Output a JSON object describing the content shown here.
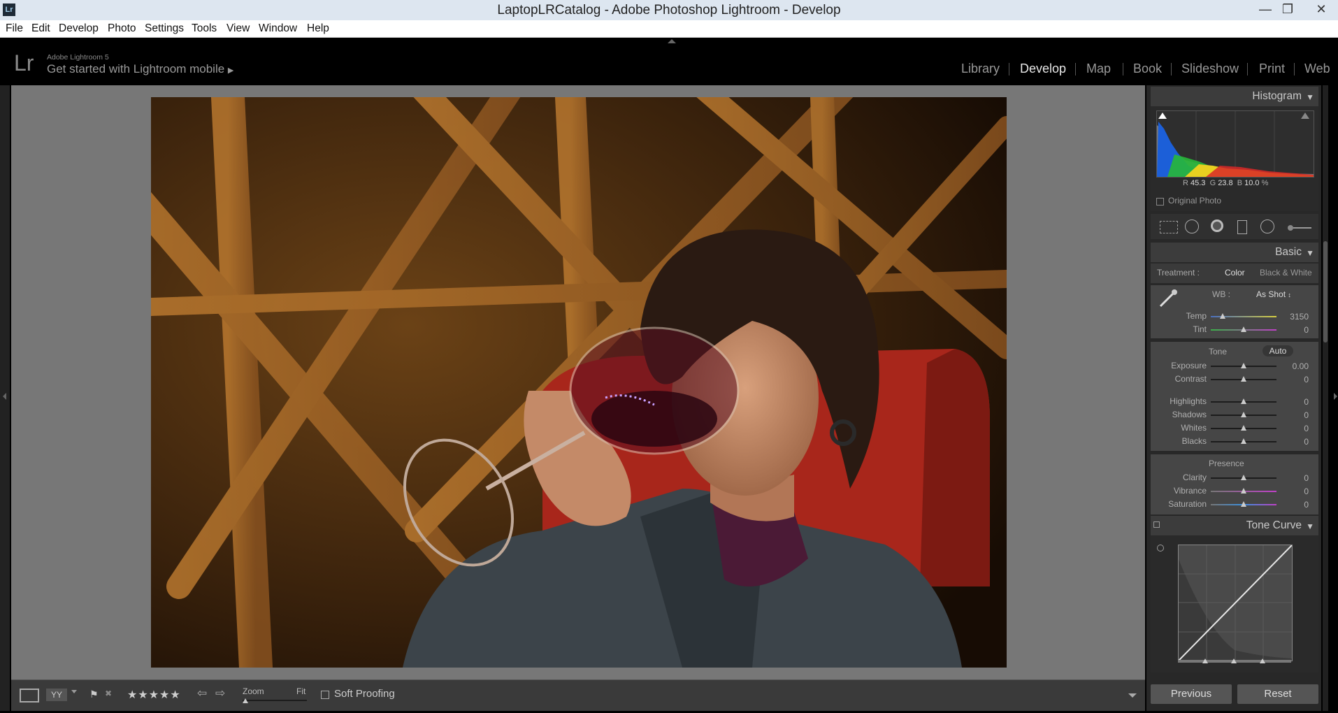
{
  "window": {
    "title": "LaptopLRCatalog - Adobe Photoshop Lightroom - Develop",
    "app_icon": "Lr",
    "controls": [
      "minimize-icon",
      "restore-icon",
      "close-icon"
    ]
  },
  "menu": [
    "File",
    "Edit",
    "Develop",
    "Photo",
    "Settings",
    "Tools",
    "View",
    "Window",
    "Help"
  ],
  "identity": {
    "logo": "Lr",
    "brand": "Adobe Lightroom 5",
    "mobile_text": "Get started with Lightroom mobile",
    "modules": [
      "Library",
      "Develop",
      "Map",
      "Book",
      "Slideshow",
      "Print",
      "Web"
    ],
    "active_module": "Develop"
  },
  "histogram": {
    "title": "Histogram",
    "r_label": "R",
    "r_value": "45.3",
    "g_label": "G",
    "g_value": "23.8",
    "b_label": "B",
    "b_value": "10.0",
    "unit": "%",
    "original_photo": "Original Photo"
  },
  "basic": {
    "title": "Basic",
    "treatment_label": "Treatment :",
    "color": "Color",
    "bw": "Black & White",
    "wb_label": "WB :",
    "wb_value": "As Shot",
    "temp_label": "Temp",
    "temp_value": "3150",
    "temp_pos": 0.18,
    "tint_label": "Tint",
    "tint_value": "0",
    "tint_pos": 0.5,
    "tone_label": "Tone",
    "auto": "Auto",
    "exposure_label": "Exposure",
    "exposure_value": "0.00",
    "contrast_label": "Contrast",
    "contrast_value": "0",
    "highlights_label": "Highlights",
    "highlights_value": "0",
    "shadows_label": "Shadows",
    "shadows_value": "0",
    "whites_label": "Whites",
    "whites_value": "0",
    "blacks_label": "Blacks",
    "blacks_value": "0",
    "presence_label": "Presence",
    "clarity_label": "Clarity",
    "clarity_value": "0",
    "vibrance_label": "Vibrance",
    "vibrance_value": "0",
    "saturation_label": "Saturation",
    "saturation_value": "0"
  },
  "tone_curve": {
    "title": "Tone Curve"
  },
  "toolbar": {
    "zoom_label": "Zoom",
    "fit_label": "Fit",
    "soft_proofing": "Soft Proofing",
    "stars": "★★★★★"
  },
  "buttons": {
    "previous": "Previous",
    "reset": "Reset"
  }
}
